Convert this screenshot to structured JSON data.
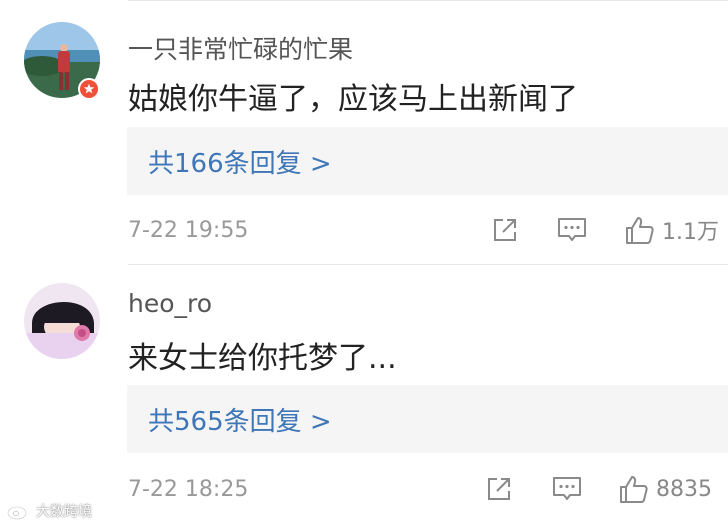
{
  "comments": [
    {
      "username": "一只非常忙碌的忙果",
      "content": "姑娘你牛逼了，应该马上出新闻了",
      "replies_label": "共166条回复 >",
      "timestamp": "7-22 19:55",
      "likes": "1.1万",
      "verified_badge": true,
      "avatar_icon": "person-on-beach-avatar"
    },
    {
      "username": "heo_ro",
      "content": "来女士给你托梦了...",
      "replies_label": "共565条回复 >",
      "timestamp": "7-22 18:25",
      "likes": "8835",
      "verified_badge": false,
      "avatar_icon": "anime-girl-avatar"
    }
  ],
  "actions": {
    "share_icon": "share-icon",
    "reply_icon": "comment-icon",
    "like_icon": "thumbs-up-icon"
  },
  "watermark": {
    "text": "大数跨境"
  },
  "colors": {
    "link": "#3f76b8",
    "reply_box_bg": "#f5f5f5",
    "badge": "#f0503a"
  }
}
